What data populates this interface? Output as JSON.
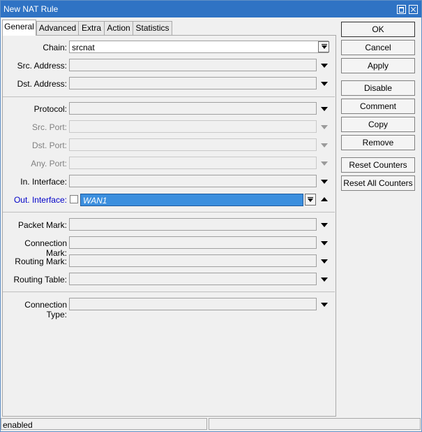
{
  "window": {
    "title": "New NAT Rule"
  },
  "tabs": [
    "General",
    "Advanced",
    "Extra",
    "Action",
    "Statistics"
  ],
  "form": {
    "chain": {
      "label": "Chain:",
      "value": "srcnat"
    },
    "src_address": {
      "label": "Src. Address:",
      "value": ""
    },
    "dst_address": {
      "label": "Dst. Address:",
      "value": ""
    },
    "protocol": {
      "label": "Protocol:",
      "value": ""
    },
    "src_port": {
      "label": "Src. Port:",
      "value": ""
    },
    "dst_port": {
      "label": "Dst. Port:",
      "value": ""
    },
    "any_port": {
      "label": "Any. Port:",
      "value": ""
    },
    "in_interface": {
      "label": "In. Interface:",
      "value": ""
    },
    "out_interface": {
      "label": "Out. Interface:",
      "value": "WAN1",
      "negate_checked": false
    },
    "packet_mark": {
      "label": "Packet Mark:",
      "value": ""
    },
    "connection_mark": {
      "label": "Connection Mark:",
      "value": ""
    },
    "routing_mark": {
      "label": "Routing Mark:",
      "value": ""
    },
    "routing_table": {
      "label": "Routing Table:",
      "value": ""
    },
    "connection_type": {
      "label": "Connection Type:",
      "value": ""
    }
  },
  "buttons": {
    "ok": "OK",
    "cancel": "Cancel",
    "apply": "Apply",
    "disable": "Disable",
    "comment": "Comment",
    "copy": "Copy",
    "remove": "Remove",
    "reset_counters": "Reset Counters",
    "reset_all_counters": "Reset All Counters"
  },
  "status": {
    "left": "enabled",
    "right": ""
  },
  "colors": {
    "titlebar": "#2f73c4",
    "selection": "#3c8fde",
    "highlight_label": "#0000c8"
  }
}
